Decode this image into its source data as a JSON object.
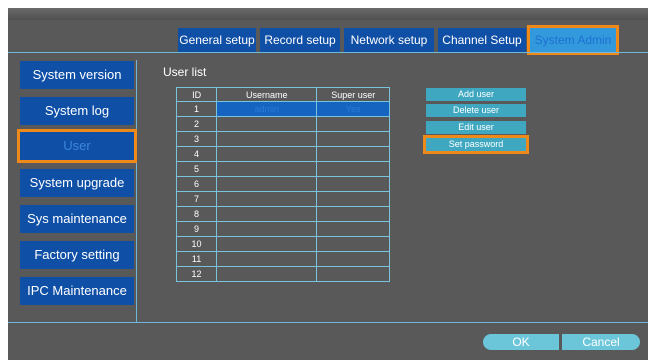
{
  "tabs": [
    {
      "label": "General setup"
    },
    {
      "label": "Record setup"
    },
    {
      "label": "Network setup"
    },
    {
      "label": "Channel Setup"
    },
    {
      "label": "System Admin"
    }
  ],
  "sidebar": {
    "items": [
      {
        "label": "System version"
      },
      {
        "label": "System log"
      },
      {
        "label": "User"
      },
      {
        "label": "System upgrade"
      },
      {
        "label": "Sys maintenance"
      },
      {
        "label": "Factory setting"
      },
      {
        "label": "IPC Maintenance"
      }
    ]
  },
  "user_list": {
    "title": "User list",
    "columns": [
      "ID",
      "Username",
      "Super user"
    ],
    "rows": [
      {
        "id": "1",
        "username": "admin",
        "super": "Yes"
      },
      {
        "id": "2",
        "username": "",
        "super": ""
      },
      {
        "id": "3",
        "username": "",
        "super": ""
      },
      {
        "id": "4",
        "username": "",
        "super": ""
      },
      {
        "id": "5",
        "username": "",
        "super": ""
      },
      {
        "id": "6",
        "username": "",
        "super": ""
      },
      {
        "id": "7",
        "username": "",
        "super": ""
      },
      {
        "id": "8",
        "username": "",
        "super": ""
      },
      {
        "id": "9",
        "username": "",
        "super": ""
      },
      {
        "id": "10",
        "username": "",
        "super": ""
      },
      {
        "id": "11",
        "username": "",
        "super": ""
      },
      {
        "id": "12",
        "username": "",
        "super": ""
      }
    ]
  },
  "actions": {
    "add_user": "Add user",
    "delete_user": "Delete user",
    "edit_user": "Edit user",
    "set_password": "Set password"
  },
  "footer": {
    "ok": "OK",
    "cancel": "Cancel"
  },
  "colors": {
    "background": "#595959",
    "tab_blue": "#0f4fa6",
    "highlight_orange": "#ef8a1a",
    "action_teal": "#3fa8c0",
    "line_cyan": "#6fb7d8"
  }
}
